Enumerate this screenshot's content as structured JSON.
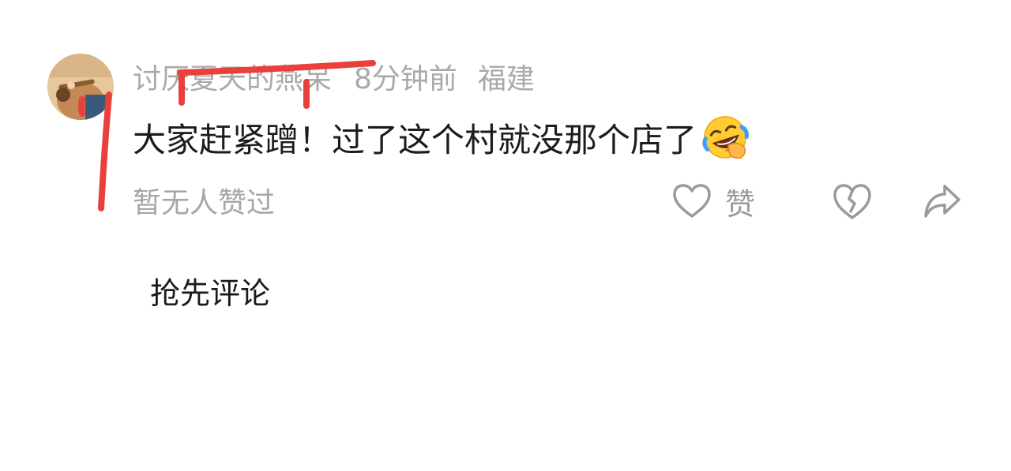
{
  "comment": {
    "username": "讨厌夏天的燕呆",
    "time_ago": "8分钟前",
    "location": "福建",
    "text": "大家赶紧蹭！过了这个村就没那个店了",
    "emoji": "rolling-on-floor-laughing-emoji",
    "likes_status": "暂无人赞过",
    "like_label": "赞"
  },
  "icons": {
    "like": "heart-outline-icon",
    "dislike": "broken-heart-icon",
    "share": "share-arrow-icon"
  },
  "footer": {
    "first_comment_prompt": "抢先评论"
  },
  "colors": {
    "meta_text": "#a9a9a9",
    "body_text": "#1c1c1c",
    "icon_gray": "#9a9a9a",
    "annotation_red": "#e8403c"
  }
}
